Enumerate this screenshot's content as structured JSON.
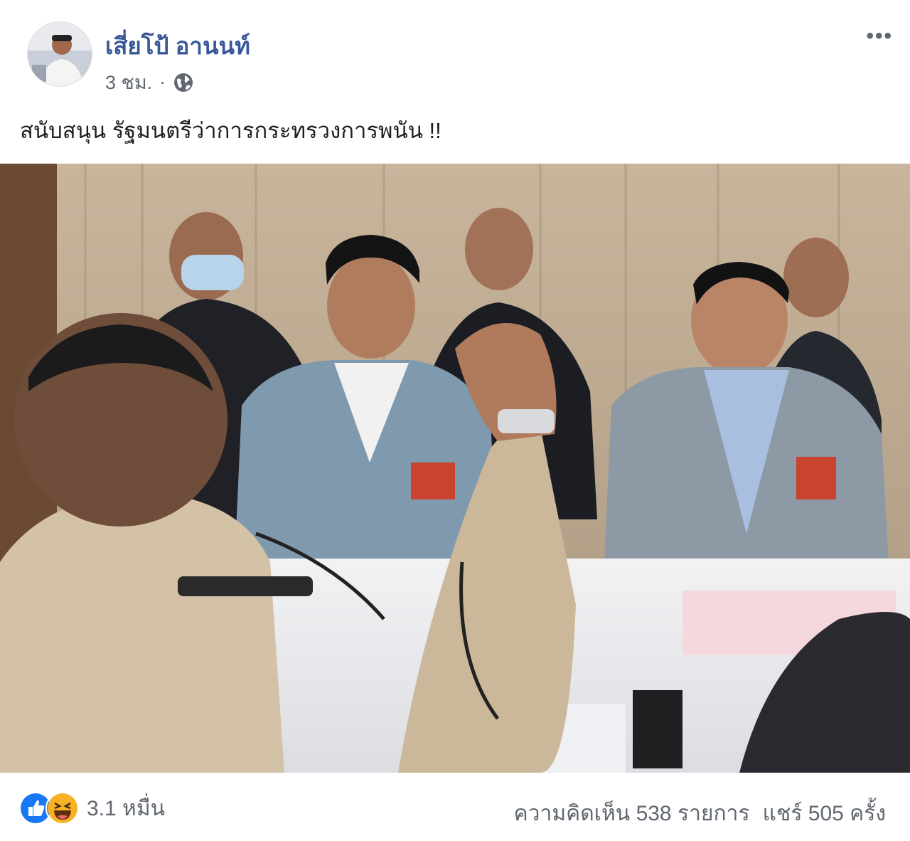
{
  "post": {
    "author": "เสี่ยโป้ อานนท์",
    "time": "3 ชม.",
    "separator": "·",
    "caption": "สนับสนุน รัฐมนตรีว่าการกระทรวงการพนัน !!",
    "more_label": "•••"
  },
  "footer": {
    "reaction_count": "3.1 หมื่น",
    "comments": "ความคิดเห็น 538 รายการ",
    "shares": "แชร์ 505 ครั้ง"
  },
  "icons": {
    "privacy": "globe-icon",
    "like": "like-icon",
    "haha": "haha-icon",
    "more": "more-options-icon"
  },
  "colors": {
    "author_link": "#385898",
    "meta": "#606770",
    "like_blue": "#1877f2",
    "haha_yellow": "#f7b125"
  }
}
